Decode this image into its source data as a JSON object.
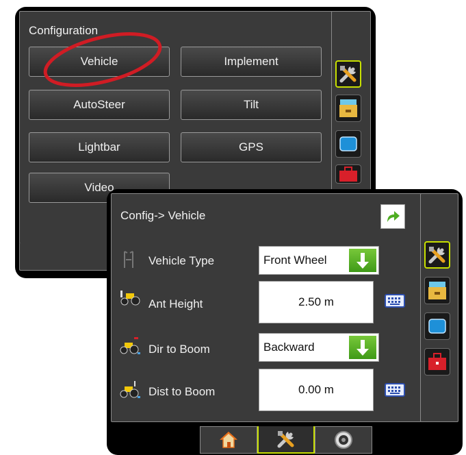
{
  "background_screen": {
    "title": "Configuration",
    "buttons": [
      "Vehicle",
      "Implement",
      "AutoSteer",
      "Tilt",
      "Lightbar",
      "GPS",
      "Video"
    ],
    "highlight_color": "#d01c24"
  },
  "foreground_screen": {
    "title": "Config-> Vehicle",
    "rows": [
      {
        "label": "Vehicle Type",
        "value": "Front Wheel",
        "control": "dropdown",
        "icon": "steering-column-icon"
      },
      {
        "label": "Ant Height",
        "value": "2.50 m",
        "control": "keypad-field",
        "icon": "tractor-antenna-icon"
      },
      {
        "label": "Dir to Boom",
        "value": "Backward",
        "control": "dropdown",
        "icon": "tractor-direction-icon"
      },
      {
        "label": "Dist to Boom",
        "value": "0.00 m",
        "control": "keypad-field",
        "icon": "tractor-distance-icon"
      }
    ]
  },
  "side_menu": [
    "tools-icon",
    "data-drawer-icon",
    "screen-icon",
    "toolbox-icon"
  ],
  "bottom_tabs": [
    "home-icon",
    "tools-icon",
    "gauge-icon"
  ],
  "colors": {
    "accent": "#c8e000",
    "arrow_green": "#4fae22",
    "panel": "#3a3a3a"
  }
}
